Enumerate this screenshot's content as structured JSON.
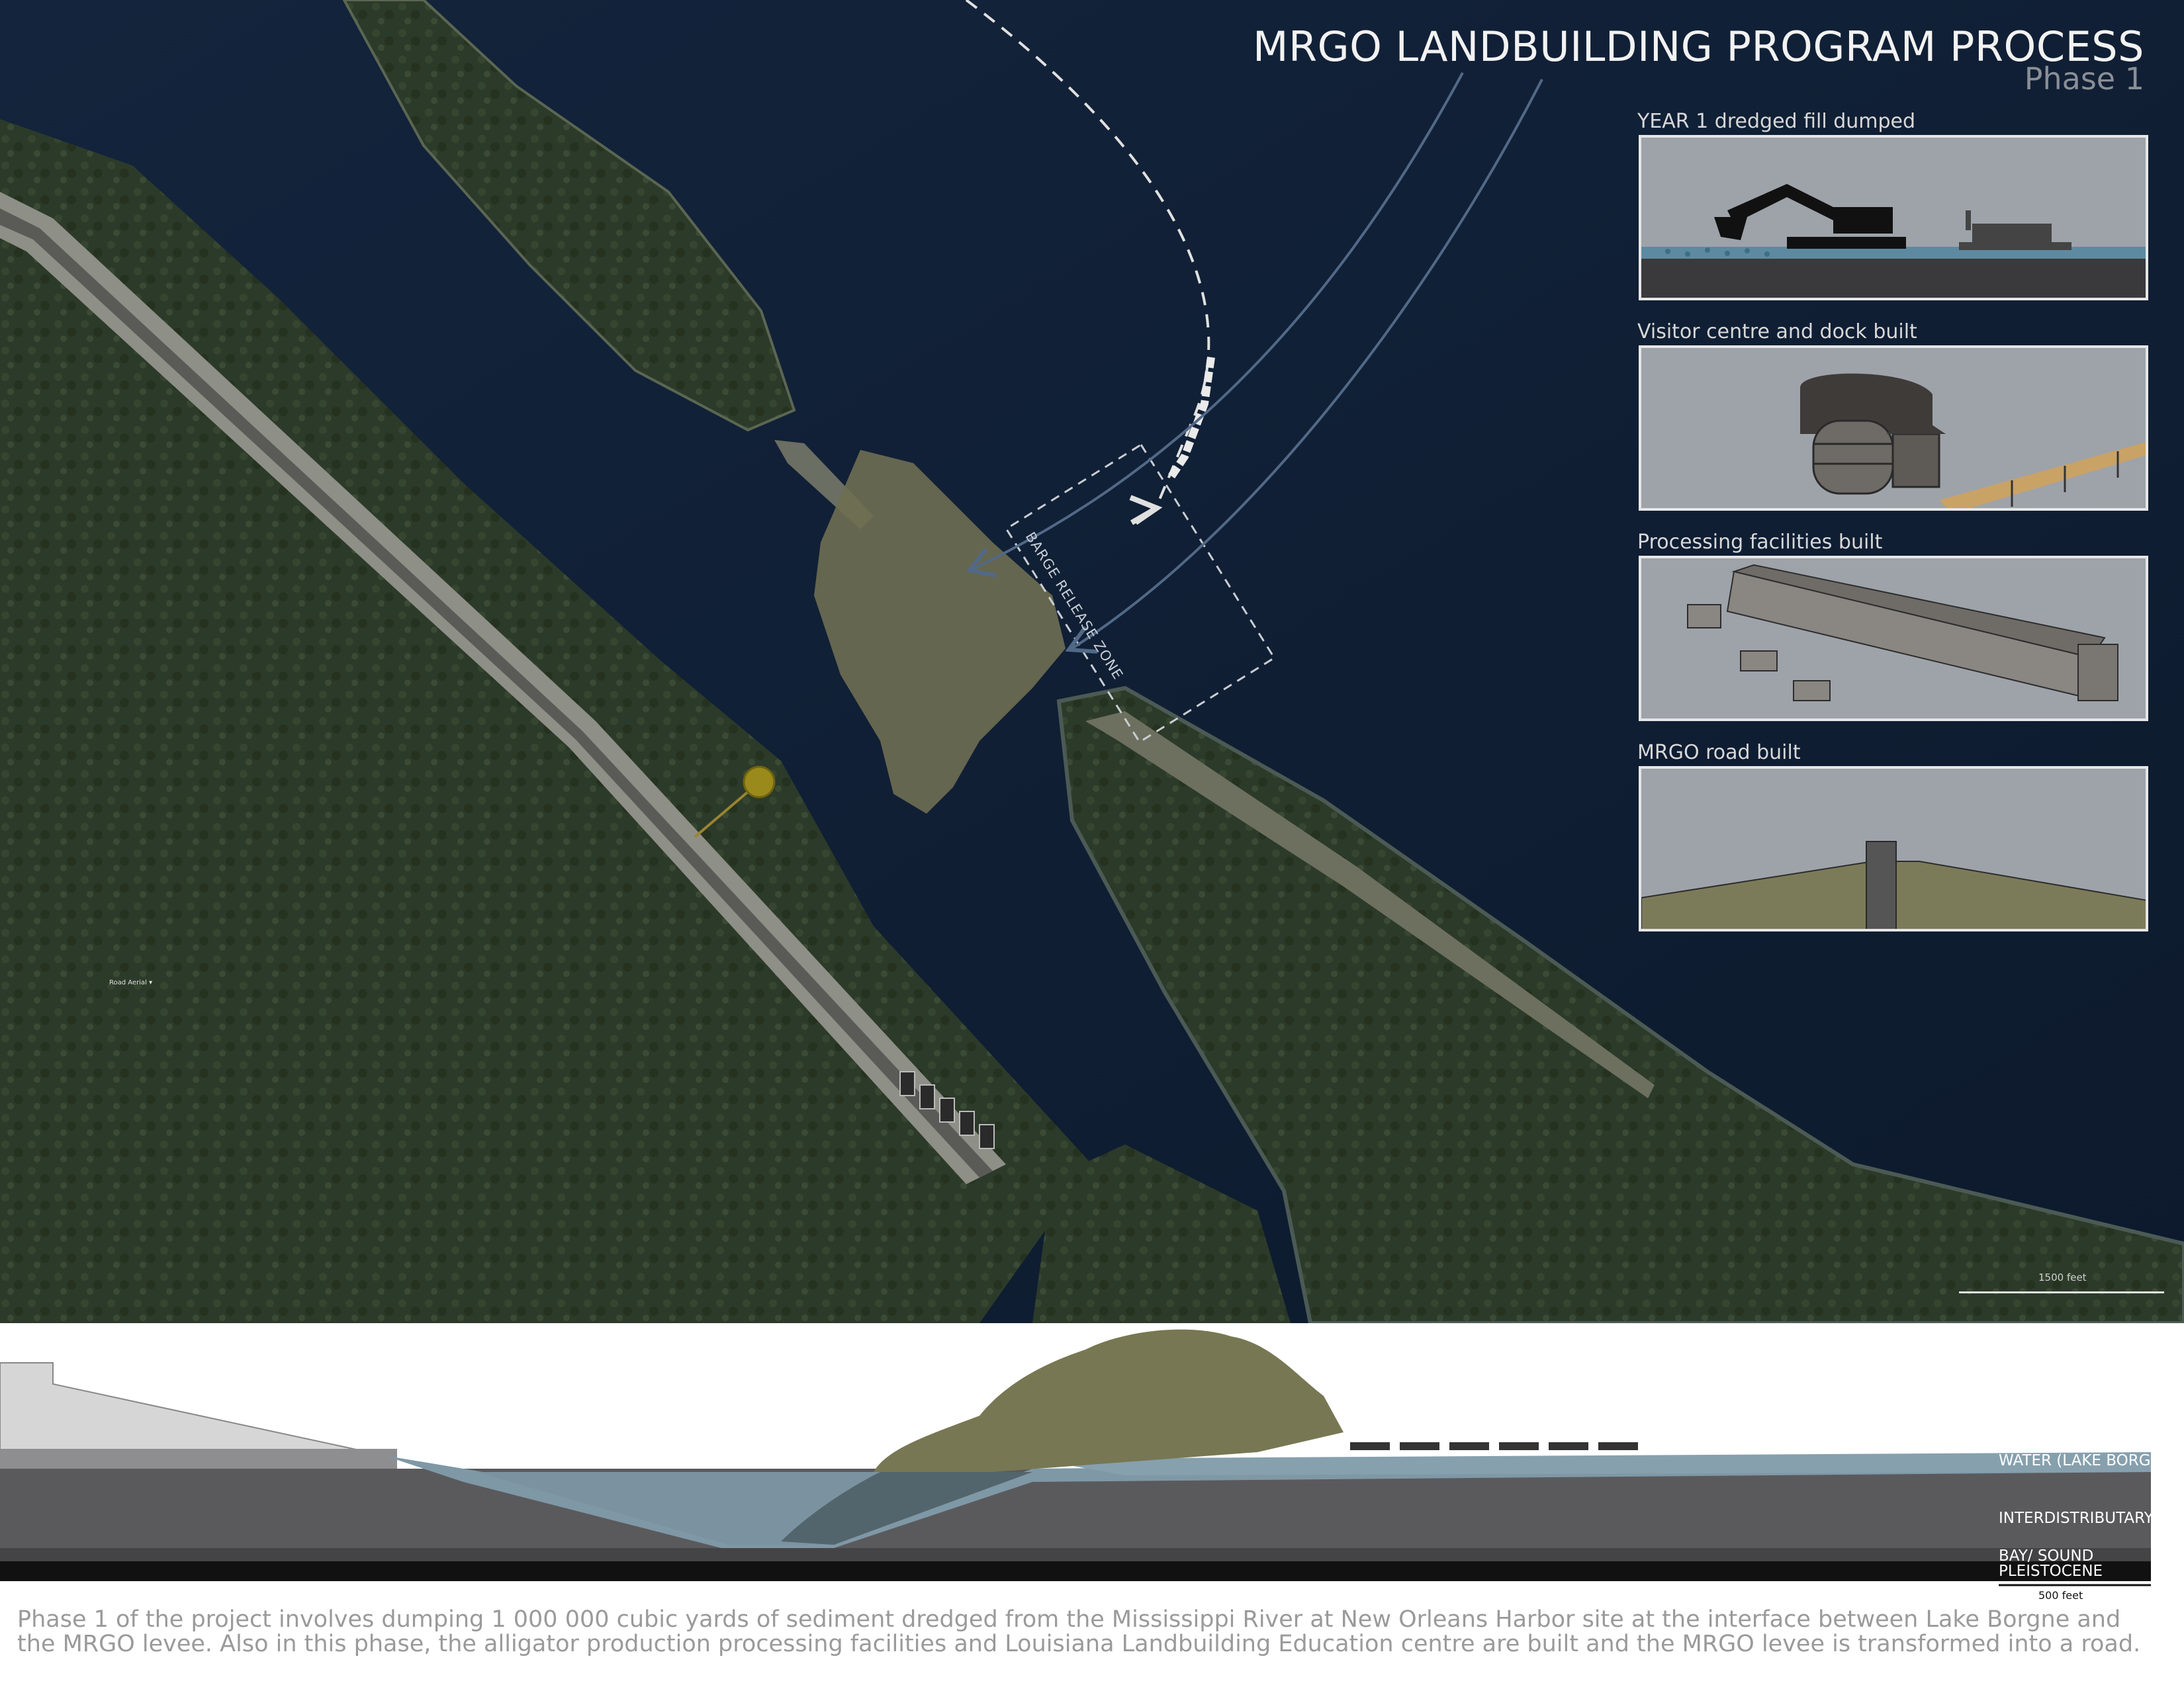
{
  "title": "MRGO LANDBUILDING PROGRAM PROCESS",
  "subtitle": "Phase 1",
  "map": {
    "zone_label": "BARGE RELEASE ZONE",
    "scale_label": "1500 feet",
    "tag": "Road   Aerial ▾"
  },
  "panels": [
    {
      "label": "YEAR 1 dredged fill dumped"
    },
    {
      "label": "Visitor centre and dock built"
    },
    {
      "label": "Processing facilities built"
    },
    {
      "label": "MRGO road built"
    }
  ],
  "section": {
    "layers": [
      {
        "label": "WATER (LAKE BORGNE)"
      },
      {
        "label": "INTERDISTRIBUTARY"
      },
      {
        "label": "BAY/ SOUND"
      },
      {
        "label": "PLEISTOCENE"
      }
    ],
    "scale_label": "500 feet"
  },
  "description": "Phase 1 of the project involves dumping 1 000 000 cubic yards of sediment dredged from the Mississippi River at New Orleans Harbor site at the interface between Lake Borgne and the MRGO levee.  Also in this phase, the alligator production processing facilities and Louisiana Landbuilding Education centre are built and the MRGO levee is transformed into a road.",
  "colors": {
    "water": "#0f1e33",
    "sediment": "#7a7a55",
    "section_water": "#7f98a6",
    "section_ground": "#555558"
  }
}
